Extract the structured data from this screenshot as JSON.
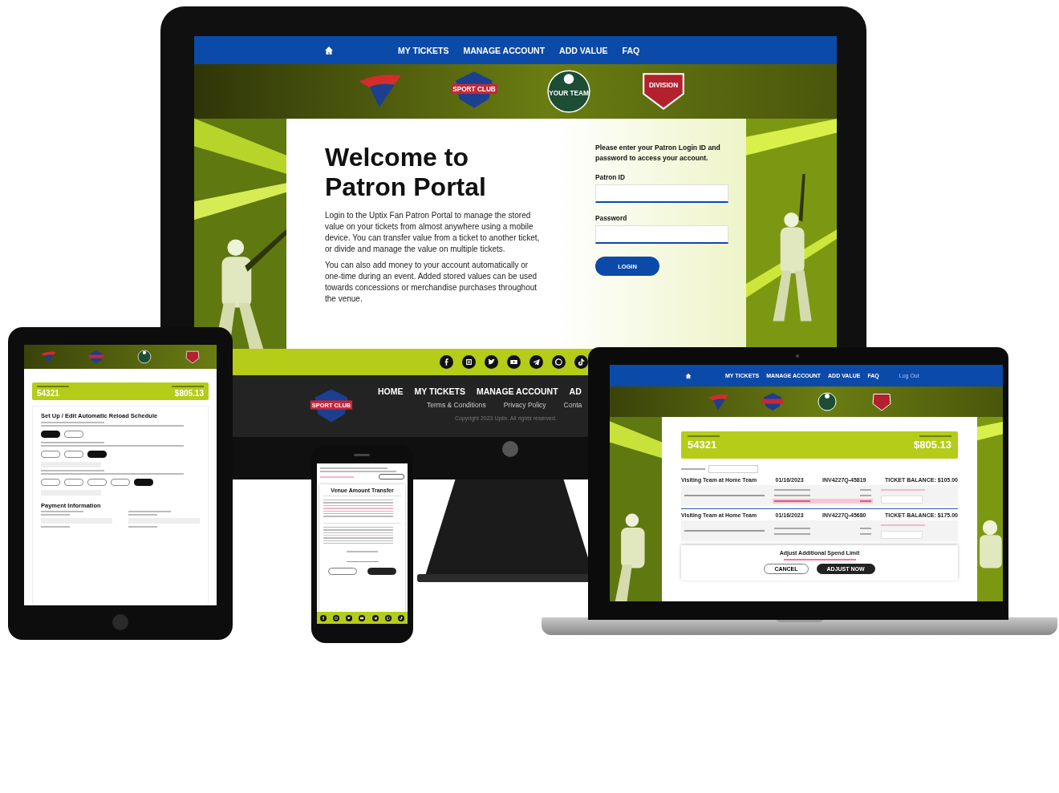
{
  "desktop": {
    "nav": [
      {
        "label": "MY TICKETS"
      },
      {
        "label": "MANAGE ACCOUNT"
      },
      {
        "label": "ADD VALUE"
      },
      {
        "label": "FAQ"
      }
    ],
    "logos": [
      {
        "kind": "bird"
      },
      {
        "kind": "star",
        "text": "SPORT CLUB"
      },
      {
        "kind": "ball",
        "text": "YOUR TEAM"
      },
      {
        "kind": "shield",
        "text": "DIVISION"
      }
    ],
    "title": [
      "Welcome to",
      "Patron Portal"
    ],
    "paragraphs": [
      "Login to the Uptix Fan Patron Portal to manage the stored value on your tickets from almost anywhere using a mobile device. You can transfer value from a ticket to another ticket, or divide and manage the value on multiple tickets.",
      "You can also add money to your account automatically or one-time during an event. Added stored values can be used towards concessions or merchandise purchases throughout the venue."
    ],
    "login": {
      "intro": "Please enter your Patron Login ID and password to access your account.",
      "fields": [
        {
          "label": "Patron ID"
        },
        {
          "label": "Password"
        }
      ],
      "button": "LOGIN"
    },
    "social": [
      {
        "kind": "facebook"
      },
      {
        "kind": "instagram"
      },
      {
        "kind": "twitter"
      },
      {
        "kind": "youtube"
      },
      {
        "kind": "telegram"
      },
      {
        "kind": "whatsapp"
      },
      {
        "kind": "tiktok"
      }
    ],
    "footer": {
      "logo_text": "SPORT CLUB",
      "links": [
        "HOME",
        "MY TICKETS",
        "MANAGE ACCOUNT",
        "AD"
      ],
      "sublinks": [
        "Terms & Conditions",
        "Privacy Policy",
        "Conta"
      ],
      "copyright": "Copyright 2023 Uptix. All rights reserved."
    }
  },
  "tablet": {
    "logos": [
      {
        "kind": "bird"
      },
      {
        "kind": "star"
      },
      {
        "kind": "ball"
      },
      {
        "kind": "shield"
      }
    ],
    "account": {
      "number": "54321",
      "balance": "$805.13"
    },
    "heading": "Set Up / Edit Automatic Reload Schedule",
    "groups": [
      {
        "pills": [
          {
            "selected": true
          },
          {
            "selected": false
          }
        ]
      },
      {
        "pills": [
          {
            "selected": false
          },
          {
            "selected": false
          },
          {
            "selected": true
          }
        ]
      },
      {
        "pills": [
          {
            "selected": false
          },
          {
            "selected": false
          },
          {
            "selected": false
          },
          {
            "selected": false
          },
          {
            "selected": true
          }
        ]
      }
    ],
    "payment_heading": "Payment Information"
  },
  "phone": {
    "heading": "Venue Amount Transfer",
    "buttons": [
      {
        "primary": false
      },
      {
        "primary": true
      }
    ],
    "social": [
      {
        "kind": "facebook"
      },
      {
        "kind": "instagram"
      },
      {
        "kind": "twitter"
      },
      {
        "kind": "youtube"
      },
      {
        "kind": "telegram"
      },
      {
        "kind": "whatsapp"
      },
      {
        "kind": "tiktok"
      }
    ]
  },
  "laptop": {
    "nav": [
      {
        "label": "MY TICKETS"
      },
      {
        "label": "MANAGE ACCOUNT"
      },
      {
        "label": "ADD VALUE"
      },
      {
        "label": "FAQ"
      }
    ],
    "logout": "Log Out",
    "logos": [
      {
        "kind": "bird"
      },
      {
        "kind": "star"
      },
      {
        "kind": "ball"
      },
      {
        "kind": "shield"
      }
    ],
    "account": {
      "number": "54321",
      "balance": "$805.13"
    },
    "tickets": [
      {
        "event": "Visiting Team at Home Team",
        "date": "01/16/2023",
        "code": "INV4227Q-45819",
        "balance": "TICKET BALANCE: $105.00",
        "amounts": [
          {
            "highlight": false
          },
          {
            "highlight": false
          },
          {
            "highlight": true
          }
        ]
      },
      {
        "event": "Visiting Team at Home Team",
        "date": "01/16/2023",
        "code": "INV4227Q-45680",
        "balance": "TICKET BALANCE: $175.00",
        "amounts": [
          {
            "highlight": false
          },
          {
            "highlight": false
          }
        ]
      }
    ],
    "modal": {
      "title": "Adjust Additional Spend Limit",
      "buttons": [
        {
          "label": "CANCEL",
          "primary": false
        },
        {
          "label": "ADJUST NOW",
          "primary": true
        }
      ]
    }
  }
}
